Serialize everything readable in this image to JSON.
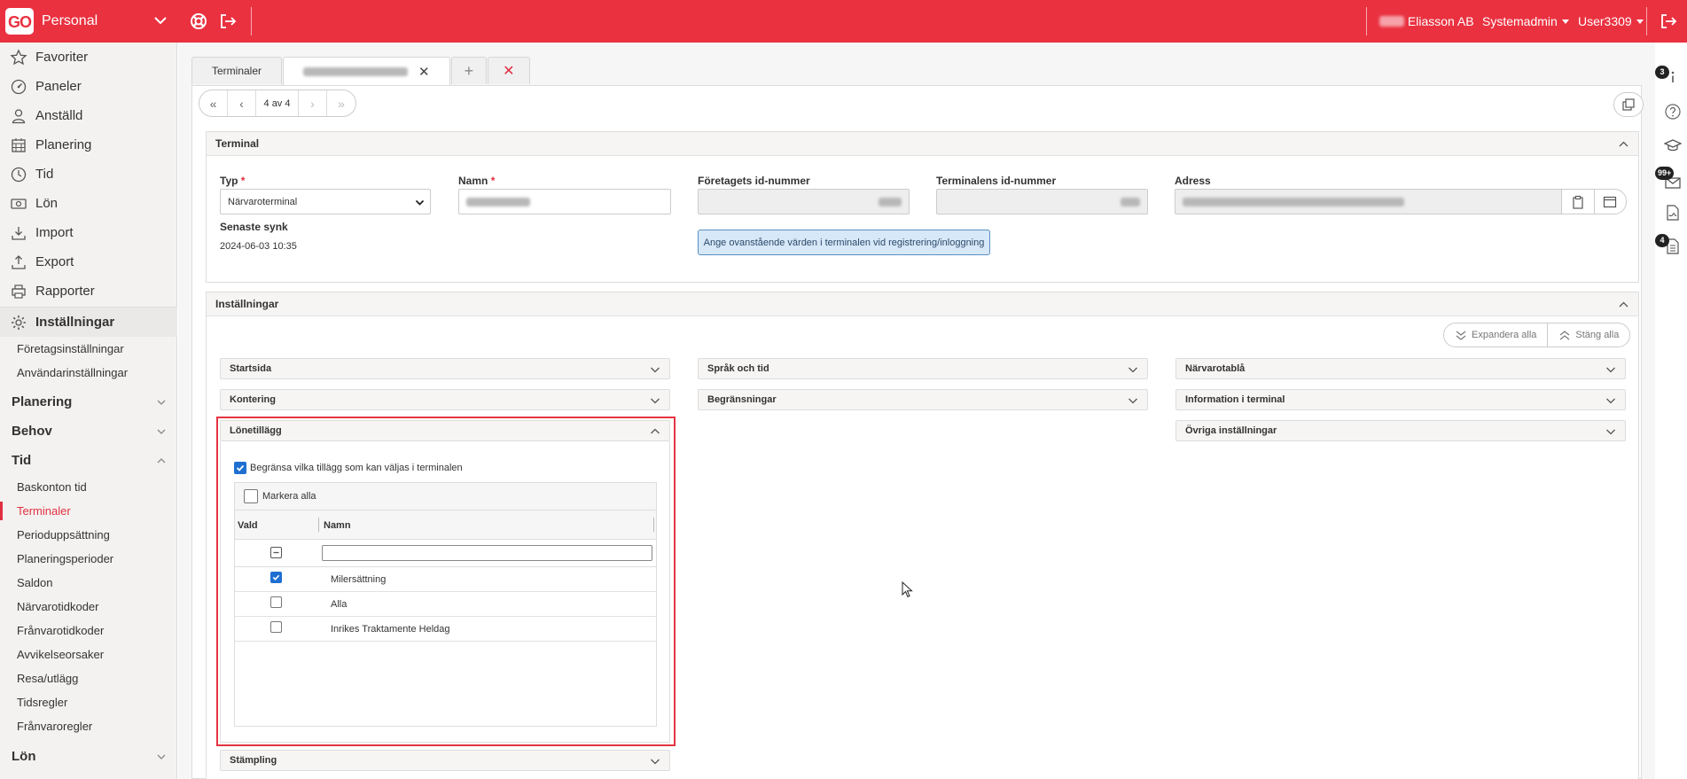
{
  "topbar": {
    "logo": "GO",
    "module": "Personal",
    "company": "Eliasson AB",
    "role": "Systemadmin",
    "user": "User3309"
  },
  "sidebar": {
    "main_items": [
      {
        "label": "Favoriter",
        "icon": "star-icon"
      },
      {
        "label": "Paneler",
        "icon": "dashboard-icon"
      },
      {
        "label": "Anställd",
        "icon": "person-icon"
      },
      {
        "label": "Planering",
        "icon": "calendar-icon"
      },
      {
        "label": "Tid",
        "icon": "clock-icon"
      },
      {
        "label": "Lön",
        "icon": "money-icon"
      },
      {
        "label": "Import",
        "icon": "import-icon"
      },
      {
        "label": "Export",
        "icon": "export-icon"
      },
      {
        "label": "Rapporter",
        "icon": "printer-icon"
      }
    ],
    "settings_label": "Inställningar",
    "settings_subs": [
      "Företagsinställningar",
      "Användarinställningar"
    ],
    "group_planering": "Planering",
    "group_behov": "Behov",
    "group_tid": "Tid",
    "tid_subs": [
      "Baskonton tid",
      "Terminaler",
      "Perioduppsättning",
      "Planeringsperioder",
      "Saldon",
      "Närvarotidkoder",
      "Frånvarotidkoder",
      "Avvikelseorsaker",
      "Resa/utlägg",
      "Tidsregler",
      "Frånvaroregler"
    ],
    "active_sub": "Terminaler",
    "group_lon": "Lön"
  },
  "tabs": {
    "first": "Terminaler",
    "plus": "+",
    "close": "✕"
  },
  "pager": {
    "count": "4 av 4"
  },
  "terminal": {
    "title": "Terminal",
    "typ_label": "Typ",
    "typ_value": "Närvaroterminal",
    "namn_label": "Namn",
    "foretag_label": "Företagets id-nummer",
    "terminal_id_label": "Terminalens id-nummer",
    "adress_label": "Adress",
    "senaste_label": "Senaste synk",
    "senaste_value": "2024-06-03 10:35",
    "ange_button": "Ange ovanstående värden i terminalen vid registrering/inloggning",
    "required_mark": "*"
  },
  "installningar": {
    "title": "Inställningar",
    "expand_all": "Expandera alla",
    "close_all": "Stäng alla",
    "col1": [
      "Startsida",
      "Kontering",
      "Lönetillägg",
      "Stämpling"
    ],
    "col2": [
      "Språk och tid",
      "Begränsningar"
    ],
    "col3": [
      "Närvarotablå",
      "Information i terminal",
      "Övriga inställningar"
    ],
    "restrict_label": "Begränsa vilka tillägg som kan väljas i terminalen",
    "select_all": "Markera alla",
    "col_vald": "Vald",
    "col_namn": "Namn",
    "rows": [
      {
        "name": "Milersättning",
        "checked": true
      },
      {
        "name": "Alla",
        "checked": false
      },
      {
        "name": "Inrikes Traktamente Heldag",
        "checked": false
      }
    ]
  },
  "rail": {
    "badge_info": "3",
    "badge_mail": "99+",
    "badge_doc": "4"
  }
}
